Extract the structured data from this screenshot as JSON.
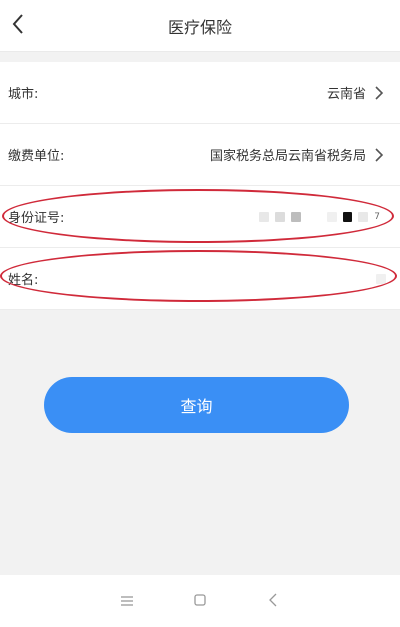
{
  "header": {
    "title": "医疗保险",
    "back_icon": "chevron-left-icon"
  },
  "form": {
    "city": {
      "label": "城市:",
      "value": "云南省"
    },
    "payer": {
      "label": "缴费单位:",
      "value": "国家税务总局云南省税务局"
    },
    "id_card": {
      "label": "身份证号:",
      "masked_suffix": "7"
    },
    "name": {
      "label": "姓名:"
    }
  },
  "actions": {
    "query_label": "查询"
  },
  "colors": {
    "accent": "#3a8ff5",
    "highlight": "#d02a3a"
  },
  "navbar": {
    "menu_icon": "menu-icon",
    "home_icon": "home-square-icon",
    "back_icon": "back-triangle-icon"
  }
}
